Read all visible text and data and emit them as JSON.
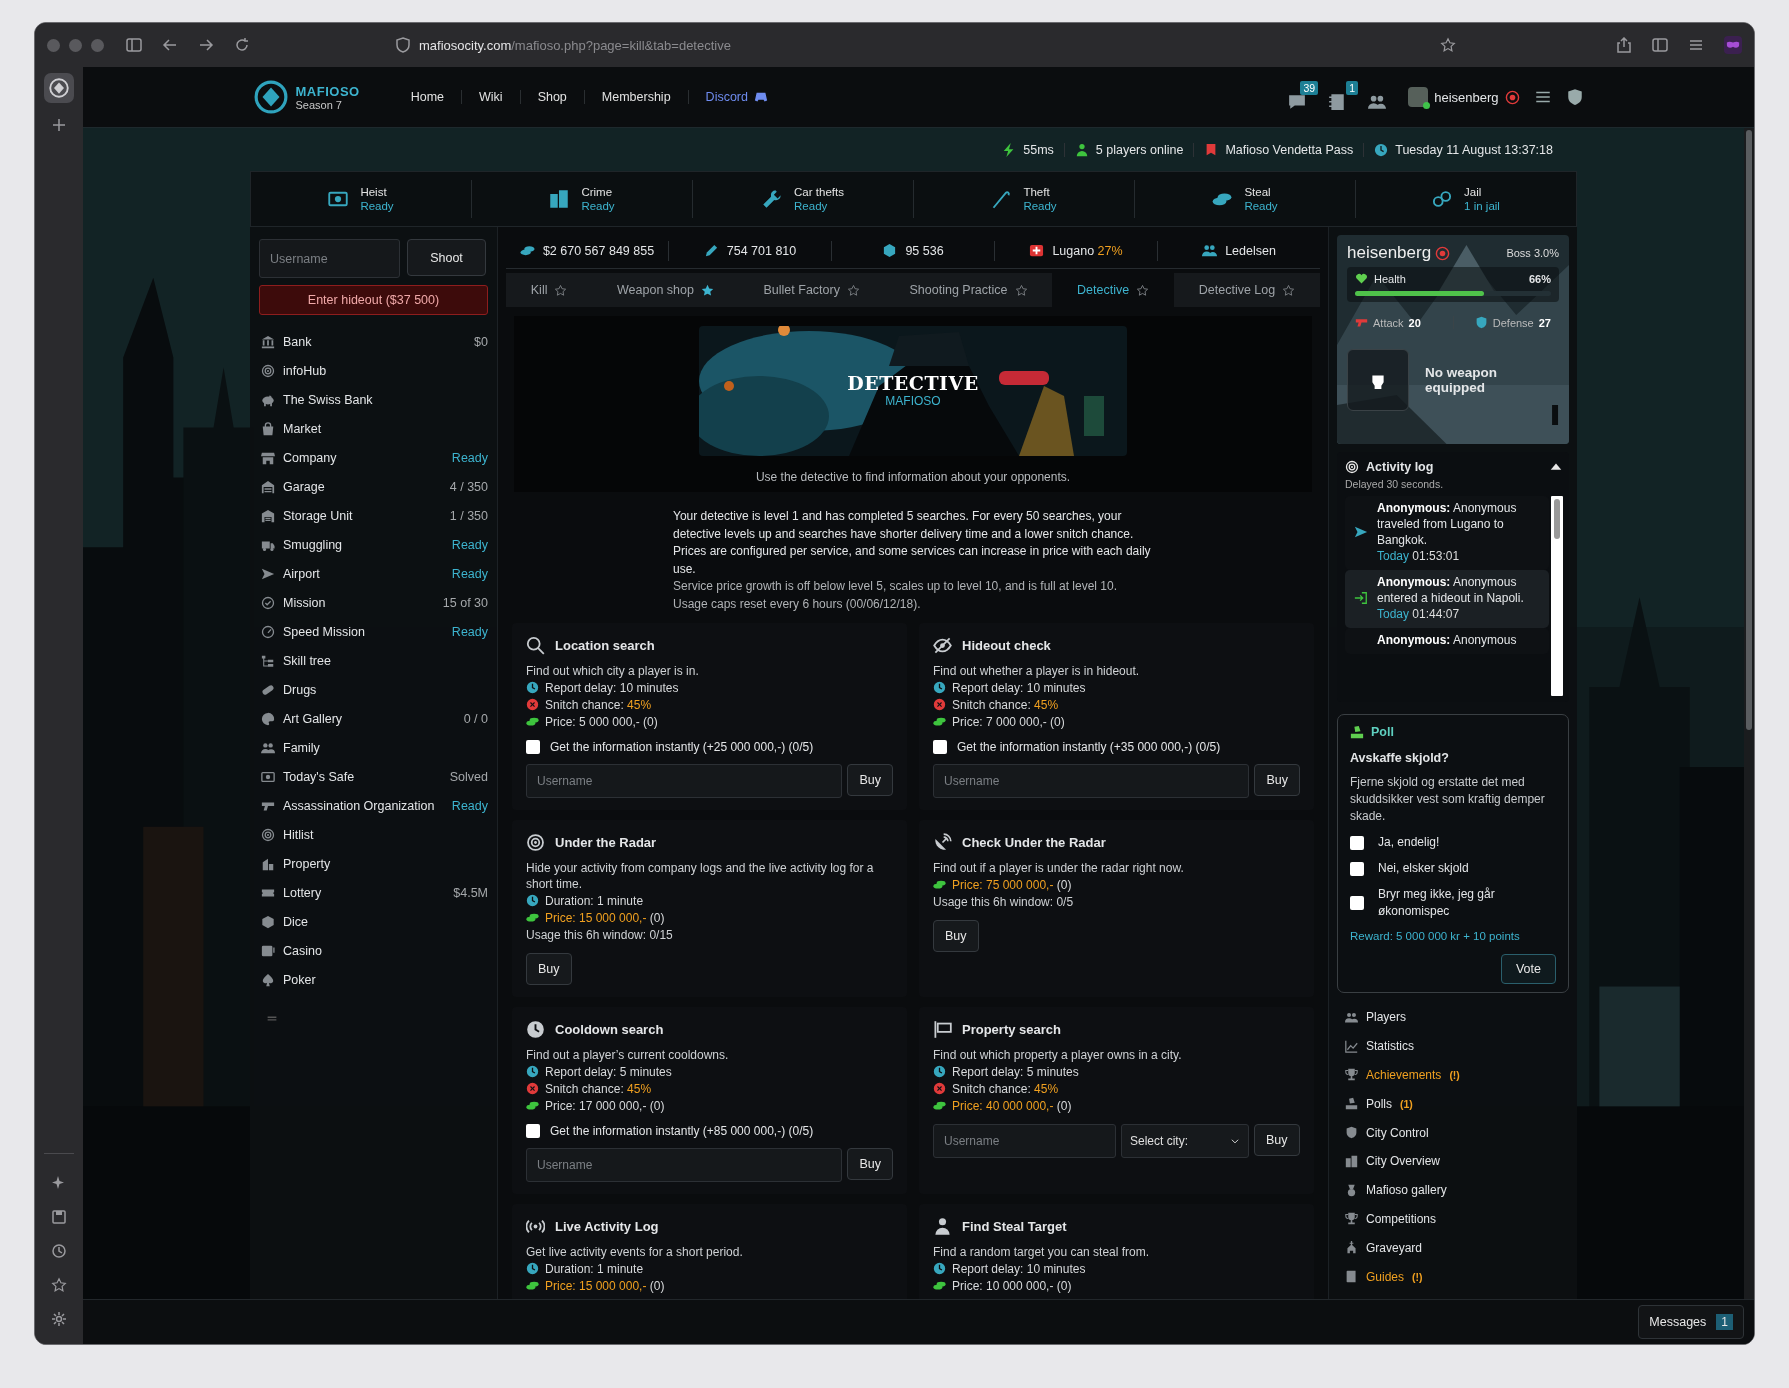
{
  "browser": {
    "url_host": "mafiosocity.com",
    "url_path": "/mafioso.php?page=kill&tab=detective"
  },
  "header": {
    "logo_title": "MAFIOSO",
    "logo_subtitle": "Season 7",
    "nav": [
      {
        "label": "Home",
        "kind": "link"
      },
      {
        "label": "Wiki",
        "kind": "link"
      },
      {
        "label": "Shop",
        "kind": "link"
      },
      {
        "label": "Membership",
        "kind": "link"
      },
      {
        "label": "Discord",
        "kind": "discord"
      }
    ],
    "messages_count": "39",
    "notifications_count": "1",
    "username": "heisenberg"
  },
  "info_bar": [
    {
      "text": "55ms"
    },
    {
      "text": "5 players online"
    },
    {
      "text": "Mafioso Vendetta Pass"
    },
    {
      "text": "Tuesday 11 August  13:37:18"
    }
  ],
  "actions": [
    {
      "label": "Heist",
      "status": "Ready"
    },
    {
      "label": "Crime",
      "status": "Ready"
    },
    {
      "label": "Car thefts",
      "status": "Ready"
    },
    {
      "label": "Theft",
      "status": "Ready"
    },
    {
      "label": "Steal",
      "status": "Ready"
    },
    {
      "label": "Jail",
      "status": "1 in jail"
    }
  ],
  "sidebar": {
    "search": {
      "placeholder": "Username"
    },
    "shoot_button": "Shoot",
    "hideout_button": "Enter hideout ($37 500)",
    "items": [
      {
        "label": "Bank",
        "value": {
          "text": "$0",
          "ready": false
        }
      },
      {
        "label": "infoHub"
      },
      {
        "label": "The Swiss Bank"
      },
      {
        "label": "Market"
      },
      {
        "label": "Company",
        "value": {
          "text": "Ready",
          "ready": true
        }
      },
      {
        "label": "Garage",
        "value": {
          "text": "4 / 350",
          "ready": false
        }
      },
      {
        "label": "Storage Unit",
        "value": {
          "text": "1 / 350",
          "ready": false
        }
      },
      {
        "label": "Smuggling",
        "value": {
          "text": "Ready",
          "ready": true
        }
      },
      {
        "label": "Airport",
        "value": {
          "text": "Ready",
          "ready": true
        }
      },
      {
        "label": "Mission",
        "value": {
          "text": "15 of 30",
          "ready": false
        }
      },
      {
        "label": "Speed Mission",
        "value": {
          "text": "Ready",
          "ready": true
        }
      },
      {
        "label": "Skill tree"
      },
      {
        "label": "Drugs"
      },
      {
        "label": "Art Gallery",
        "value": {
          "text": "0 / 0",
          "ready": false
        }
      },
      {
        "label": "Family"
      },
      {
        "label": "Today's Safe",
        "value": {
          "text": "Solved",
          "ready": false
        }
      },
      {
        "label": "Assassination Organization",
        "value": {
          "text": "Ready",
          "ready": true
        }
      },
      {
        "label": "Hitlist"
      },
      {
        "label": "Property"
      },
      {
        "label": "Lottery",
        "value": {
          "text": "$4.5M",
          "ready": false
        }
      },
      {
        "label": "Dice"
      },
      {
        "label": "Casino"
      },
      {
        "label": "Poker"
      }
    ]
  },
  "stats": [
    {
      "text": "$2 670 567 849 855"
    },
    {
      "text": "754 701 810"
    },
    {
      "text": "95 536"
    },
    {
      "text": "Lugano",
      "extra": "27%"
    },
    {
      "text": "Ledelsen"
    }
  ],
  "tabs": [
    {
      "label": "Kill",
      "selected": false,
      "starred": false
    },
    {
      "label": "Weapon shop",
      "selected": false,
      "starred": true
    },
    {
      "label": "Bullet Factory",
      "selected": false,
      "starred": false
    },
    {
      "label": "Shooting Practice",
      "selected": false,
      "starred": false
    },
    {
      "label": "Detective",
      "selected": true,
      "starred": false
    },
    {
      "label": "Detective Log",
      "selected": false,
      "starred": false
    }
  ],
  "banner": {
    "title": "DETECTIVE",
    "subtitle": "MAFIOSO",
    "caption": "Use the detective to find information about your opponents."
  },
  "intro": {
    "text": "Your detective is level 1 and has completed 5 searches. For every 50 searches, your detective levels up and searches have shorter delivery time and a lower snitch chance. Prices are configured per service, and some services can increase in price with each daily use.",
    "notes": [
      "Service price growth is off below level 5, scales up to level 10, and is full at level 10.",
      "Usage caps reset every 6 hours (00/06/12/18)."
    ]
  },
  "services": [
    {
      "title": "Location search",
      "description": "Find out which city a player is in.",
      "lines": [
        {
          "kind": "delay",
          "text": "Report delay: 10 minutes"
        },
        {
          "kind": "snitch",
          "text": "Snitch chance:",
          "value": "45%"
        },
        {
          "kind": "price",
          "text": "Price: 5 000 000,-",
          "extra": "(0)",
          "warn": false
        }
      ],
      "instant": {
        "label": "Get the information instantly (+25 000 000,-) (0/5)",
        "checked": false
      },
      "form": {
        "kind": "username",
        "placeholder": "Username",
        "button": "Buy"
      }
    },
    {
      "title": "Hideout check",
      "description": "Find out whether a player is in hideout.",
      "lines": [
        {
          "kind": "delay",
          "text": "Report delay: 10 minutes"
        },
        {
          "kind": "snitch",
          "text": "Snitch chance:",
          "value": "45%"
        },
        {
          "kind": "price",
          "text": "Price: 7 000 000,-",
          "extra": "(0)",
          "warn": false
        }
      ],
      "instant": {
        "label": "Get the information instantly (+35 000 000,-) (0/5)",
        "checked": false
      },
      "form": {
        "kind": "username",
        "placeholder": "Username",
        "button": "Buy"
      }
    },
    {
      "title": "Under the Radar",
      "description": "Hide your activity from company logs and the live activity log for a short time.",
      "lines": [
        {
          "kind": "duration",
          "text": "Duration: 1 minute"
        },
        {
          "kind": "price",
          "text": "Price: 15 000 000,-",
          "extra": "(0)",
          "warn": true
        },
        {
          "kind": "usage",
          "text": "Usage this 6h window: 0/15"
        }
      ],
      "form": {
        "kind": "button",
        "button": "Buy"
      }
    },
    {
      "title": "Check Under the Radar",
      "description": "Find out if a player is under the radar right now.",
      "lines": [
        {
          "kind": "price",
          "text": "Price: 75 000 000,-",
          "extra": "(0)",
          "warn": true
        },
        {
          "kind": "usage",
          "text": "Usage this 6h window: 0/5"
        }
      ],
      "form": {
        "kind": "button",
        "button": "Buy"
      }
    },
    {
      "title": "Cooldown search",
      "description": "Find out a player’s current cooldowns.",
      "lines": [
        {
          "kind": "delay",
          "text": "Report delay: 5 minutes"
        },
        {
          "kind": "snitch",
          "text": "Snitch chance:",
          "value": "45%"
        },
        {
          "kind": "price",
          "text": "Price: 17 000 000,-",
          "extra": "(0)",
          "warn": false
        }
      ],
      "instant": {
        "label": "Get the information instantly (+85 000 000,-) (0/5)",
        "checked": false
      },
      "form": {
        "kind": "username",
        "placeholder": "Username",
        "button": "Buy"
      }
    },
    {
      "title": "Property search",
      "description": "Find out which property a player owns in a city.",
      "lines": [
        {
          "kind": "delay",
          "text": "Report delay: 5 minutes"
        },
        {
          "kind": "snitch",
          "text": "Snitch chance:",
          "value": "45%"
        },
        {
          "kind": "price",
          "text": "Price: 40 000 000,-",
          "extra": "(0)",
          "warn": true
        }
      ],
      "form": {
        "kind": "username_city",
        "placeholder": "Username",
        "select": "Select city:",
        "button": "Buy"
      }
    },
    {
      "title": "Live Activity Log",
      "description": "Get live activity events for a short period.",
      "lines": [
        {
          "kind": "duration",
          "text": "Duration: 1 minute"
        },
        {
          "kind": "price",
          "text": "Price: 15 000 000,-",
          "extra": "(0)",
          "warn": true
        }
      ]
    },
    {
      "title": "Find Steal Target",
      "description": "Find a random target you can steal from.",
      "lines": [
        {
          "kind": "delay",
          "text": "Report delay: 10 minutes"
        },
        {
          "kind": "price",
          "text": "Price: 10 000 000,-",
          "extra": "(0)",
          "warn": false
        }
      ]
    }
  ],
  "profile": {
    "name": "heisenberg",
    "rank": "Boss",
    "rank_progress": "3.0%",
    "health": {
      "label": "Health",
      "value": "66%",
      "level": 0.66
    },
    "attack_label": "Attack",
    "attack": "20",
    "defense_label": "Defense",
    "defense": "27",
    "weapon": "No weapon equipped"
  },
  "activity_log": {
    "title": "Activity log",
    "subtitle": "Delayed 30 seconds.",
    "entries": [
      {
        "kind": "travel",
        "who": "Anonymous:",
        "text": "Anonymous traveled from Lugano to Bangkok.",
        "day": "Today",
        "time": "01:53:01",
        "highlighted": false
      },
      {
        "kind": "hideout",
        "who": "Anonymous:",
        "text": "Anonymous entered a hideout in Napoli.",
        "day": "Today",
        "time": "01:44:07",
        "highlighted": true
      },
      {
        "who": "Anonymous:",
        "text": "Anonymous",
        "highlighted": false
      }
    ]
  },
  "poll": {
    "title": "Poll",
    "question": "Avskaffe skjold?",
    "description": "Fjerne skjold og erstatte det med skuddsikker vest som kraftig demper skade.",
    "options": [
      {
        "label": "Ja, endelig!",
        "checked": false
      },
      {
        "label": "Nei, elsker skjold",
        "checked": false
      },
      {
        "label": "Bryr meg ikke, jeg går økonomispec",
        "checked": false
      }
    ],
    "reward": "Reward: 5 000 000 kr + 10 points",
    "button": "Vote"
  },
  "links": [
    {
      "label": "Players",
      "highlight": false
    },
    {
      "label": "Statistics",
      "highlight": false
    },
    {
      "label": "Achievements",
      "badge": "(!)",
      "highlight": true
    },
    {
      "label": "Polls",
      "badge": "(1)",
      "highlight": false
    },
    {
      "label": "City Control",
      "highlight": false
    },
    {
      "label": "City Overview",
      "highlight": false
    },
    {
      "label": "Mafioso gallery",
      "highlight": false
    },
    {
      "label": "Competitions",
      "highlight": false
    },
    {
      "label": "Graveyard",
      "highlight": false
    },
    {
      "label": "Guides",
      "badge": "(!)",
      "highlight": true
    }
  ],
  "messages": {
    "label": "Messages",
    "count": "1"
  }
}
